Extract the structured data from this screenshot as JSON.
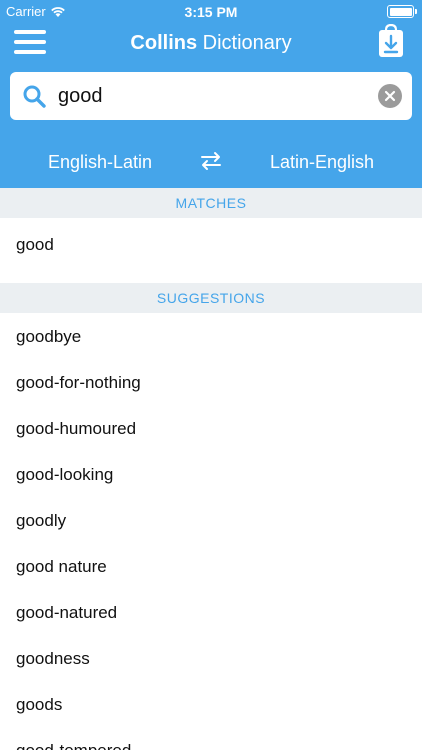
{
  "status": {
    "carrier": "Carrier",
    "time": "3:15 PM"
  },
  "header": {
    "title_bold": "Collins",
    "title_rest": " Dictionary"
  },
  "search": {
    "value": "good"
  },
  "languages": {
    "left": "English-Latin",
    "right": "Latin-English"
  },
  "matches": {
    "header": "MATCHES",
    "items": [
      "good"
    ]
  },
  "suggestions": {
    "header": "SUGGESTIONS",
    "items": [
      "goodbye",
      "good-for-nothing",
      "good-humoured",
      "good-looking",
      "goodly",
      "good nature",
      "good-natured",
      "goodness",
      "goods",
      "good-tempered"
    ]
  },
  "colors": {
    "accent": "#45a5ea",
    "section_bg": "#ebeff2",
    "clear": "#9b9b9b"
  },
  "icons": {
    "menu": "hamburger-icon",
    "download": "download-icon",
    "search": "search-icon",
    "clear": "clear-icon",
    "swap": "swap-arrows-icon"
  }
}
